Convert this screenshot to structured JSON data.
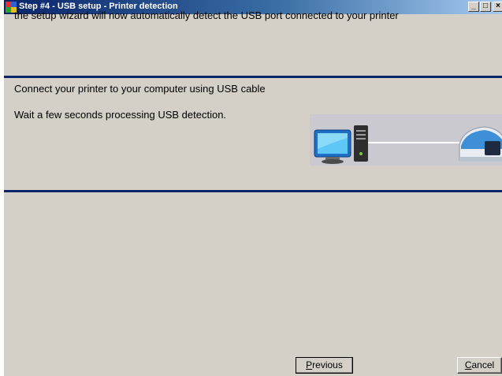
{
  "window": {
    "title": "Step #4 - USB setup - Printer detection",
    "controls": {
      "minimize": "_",
      "maximize": "□",
      "close": "×"
    }
  },
  "content": {
    "intro": "the setup wizard will now automatically detect the USB port connected to your printer",
    "connect": "Connect your printer to your computer using USB cable",
    "wait": "Wait a few seconds processing USB detection."
  },
  "illustration": {
    "left_icon": "computer-icon",
    "right_icon": "card-printer-icon"
  },
  "buttons": {
    "previous": "Previous",
    "cancel": "Cancel"
  },
  "colors": {
    "titlebar_start": "#0a246a",
    "titlebar_end": "#a6caf0",
    "divider": "#0a246a",
    "window_bg": "#d4d0c8"
  }
}
